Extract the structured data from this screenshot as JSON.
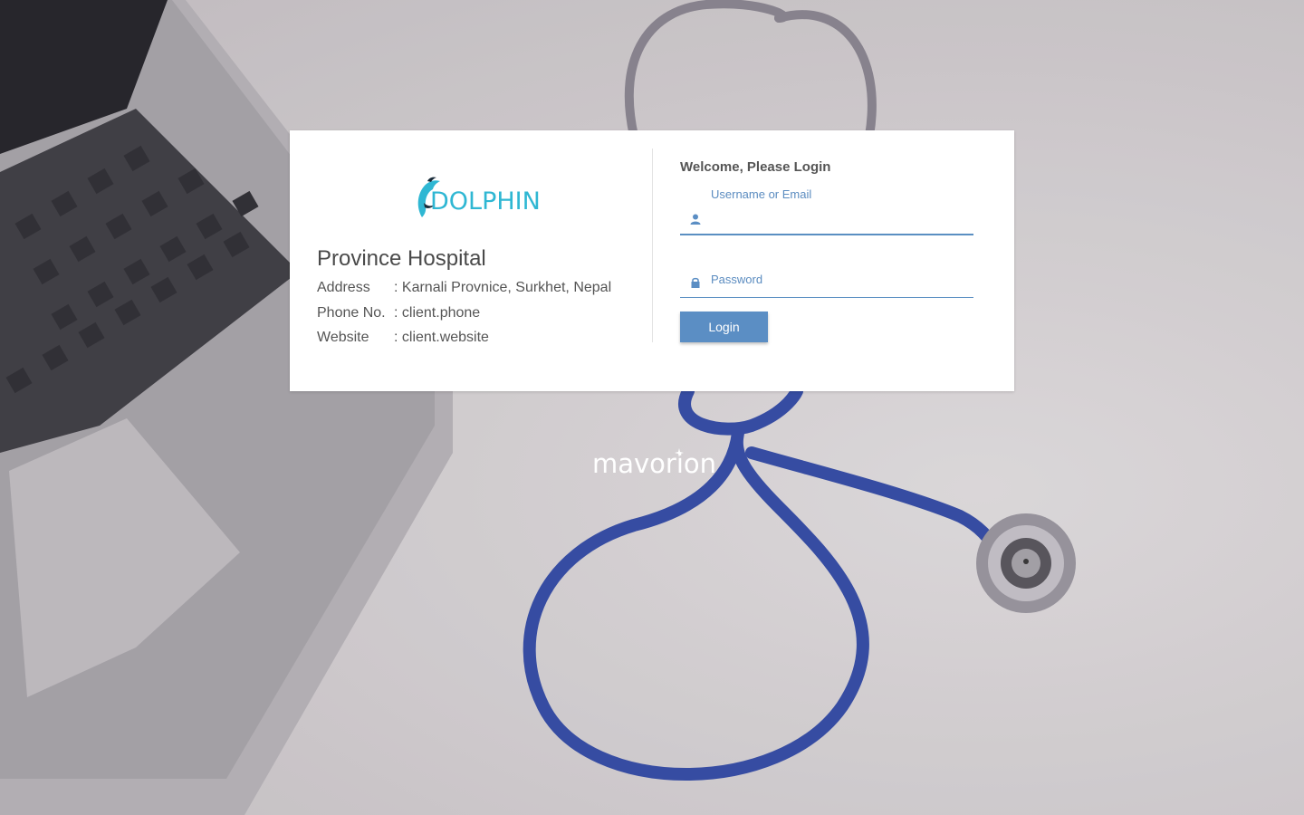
{
  "brand": {
    "app_logo_text": "DOLPHIN",
    "vendor_logo_text": "mavorion",
    "logo_color": "#2fb7d3"
  },
  "hospital": {
    "name": "Province Hospital",
    "address_label": "Address",
    "address_value": ": Karnali Provnice, Surkhet, Nepal",
    "phone_label": "Phone No.",
    "phone_value": ": client.phone",
    "website_label": "Website",
    "website_value": ": client.website"
  },
  "login": {
    "heading": "Welcome, Please Login",
    "username_label": "Username or Email",
    "username_icon": "user-icon",
    "password_label": "Password",
    "password_icon": "lock-icon",
    "submit_label": "Login",
    "accent_color": "#5b8ec4"
  }
}
